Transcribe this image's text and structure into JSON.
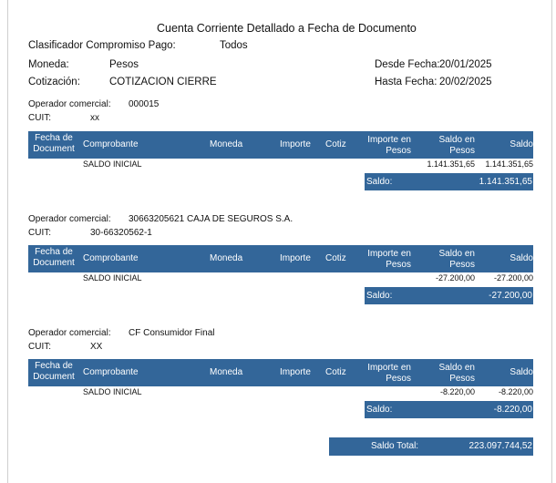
{
  "report": {
    "title": "Cuenta Corriente Detallado a Fecha de Documento",
    "clasificador_label": "Clasificador Compromiso Pago:",
    "clasificador_value": "Todos",
    "moneda_label": "Moneda:",
    "moneda_value": "Pesos",
    "cotizacion_label": "Cotización:",
    "cotizacion_value": "COTIZACION CIERRE",
    "desde_label": "Desde Fecha:",
    "desde_value": "20/01/2025",
    "hasta_label": "Hasta  Fecha:",
    "hasta_value": "20/02/2025"
  },
  "columns": {
    "fecha_line1": "Fecha de",
    "fecha_line2": "Document",
    "comprobante": "Comprobante",
    "moneda": "Moneda",
    "importe": "Importe",
    "cotiz": "Cotiz",
    "importe_pesos_line1": "Importe en",
    "importe_pesos_line2": "Pesos",
    "saldo_pesos_line1": "Saldo en",
    "saldo_pesos_line2": "Pesos",
    "saldo": "Saldo"
  },
  "sections": [
    {
      "operador_label": "Operador comercial:",
      "operador_value": "000015",
      "cuit_label": "CUIT:",
      "cuit_value": "xx",
      "row_comprobante": "SALDO INICIAL",
      "row_saldo_pesos": "1.141.351,65",
      "row_saldo": "1.141.351,65",
      "saldo_label": "Saldo:",
      "saldo_value": "1.141.351,65"
    },
    {
      "operador_label": "Operador comercial:",
      "operador_value": "30663205621  CAJA DE SEGUROS S.A.",
      "cuit_label": "CUIT:",
      "cuit_value": "30-66320562-1",
      "row_comprobante": "SALDO INICIAL",
      "row_saldo_pesos": "-27.200,00",
      "row_saldo": "-27.200,00",
      "saldo_label": "Saldo:",
      "saldo_value": "-27.200,00"
    },
    {
      "operador_label": "Operador comercial:",
      "operador_value": "CF  Consumidor Final",
      "cuit_label": "CUIT:",
      "cuit_value": "XX",
      "row_comprobante": "SALDO INICIAL",
      "row_saldo_pesos": "-8.220,00",
      "row_saldo": "-8.220,00",
      "saldo_label": "Saldo:",
      "saldo_value": "-8.220,00"
    }
  ],
  "total": {
    "label": "Saldo Total:",
    "value": "223.097.744,52"
  },
  "colors": {
    "header_bg": "#336699",
    "header_text": "#ffffff"
  }
}
